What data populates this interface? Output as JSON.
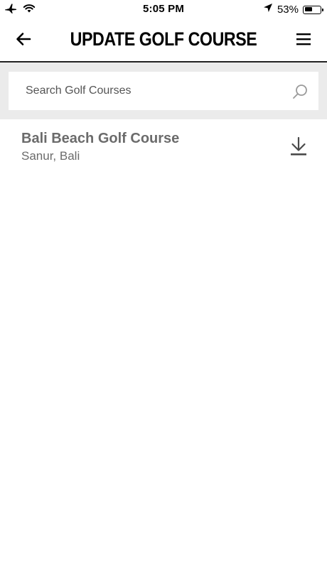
{
  "status_bar": {
    "time": "5:05 PM",
    "battery_percent": "53%",
    "battery_level": 0.53,
    "icons": [
      "airplane-icon",
      "wifi-icon",
      "location-arrow-icon",
      "battery-icon"
    ]
  },
  "header": {
    "title": "UPDATE GOLF COURSE",
    "back_icon": "back-arrow-icon",
    "menu_icon": "hamburger-menu-icon"
  },
  "search": {
    "placeholder": "Search Golf Courses",
    "value": "",
    "icon": "search-icon"
  },
  "courses": [
    {
      "name": "Bali Beach Golf Course",
      "location": "Sanur, Bali",
      "action_icon": "download-icon"
    }
  ],
  "colors": {
    "header_rule": "#222222",
    "search_background": "#ebebeb",
    "course_text": "#6b6b6b"
  }
}
